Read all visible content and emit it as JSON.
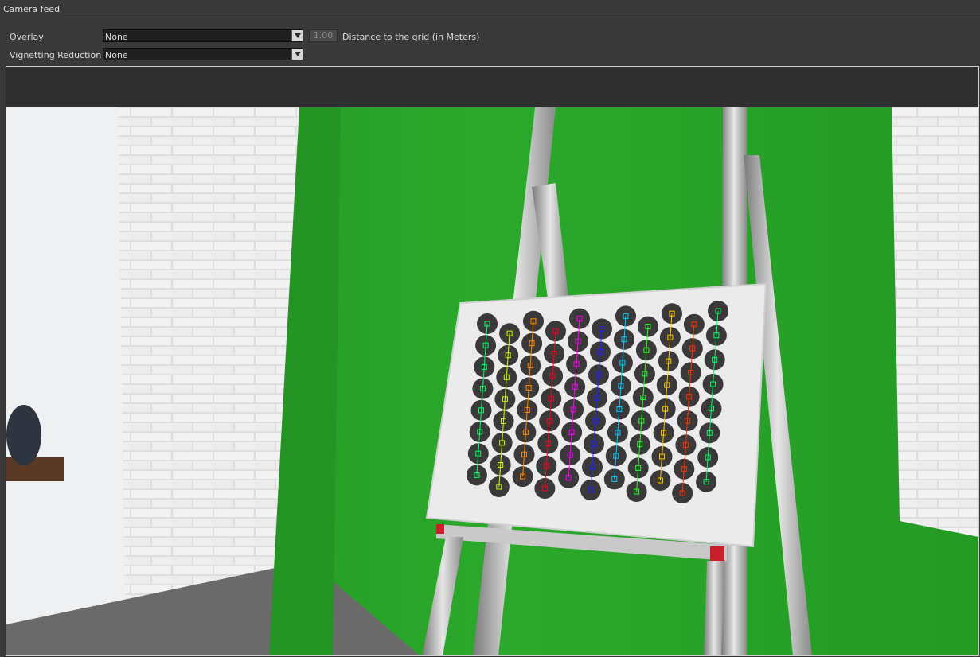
{
  "group": {
    "title": "Camera feed"
  },
  "overlay": {
    "label": "Overlay",
    "value": "None",
    "distance_value": "1.00",
    "distance_label": "Distance to the grid (in Meters)"
  },
  "vignetting": {
    "label": "Vignetting Reduction",
    "value": "None"
  },
  "icons": {
    "combo_arrow": "chevron-down-icon"
  }
}
